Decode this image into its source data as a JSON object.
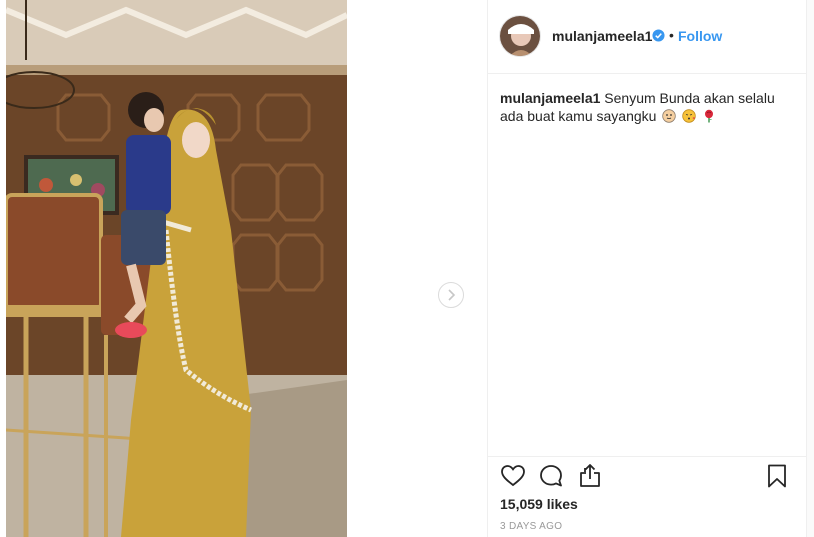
{
  "post": {
    "username": "mulanjameela1",
    "follow_label": "Follow",
    "separator": "•",
    "caption_user": "mulanjameela1",
    "caption_text": "Senyum Bunda akan selalu ada buat kamu sayangku",
    "caption_emojis": [
      "baby-face-icon",
      "kissing-face-icon",
      "rose-icon"
    ],
    "likes": "15,059 likes",
    "time_ago": "3 DAYS AGO"
  },
  "colors": {
    "accent": "#3897f0",
    "text": "#262626",
    "muted": "#999999",
    "border": "#efefef",
    "dress": "#c9a23a"
  },
  "icons": {
    "verified": "verified-badge-icon",
    "next": "chevron-right-icon",
    "like": "heart-icon",
    "comment": "comment-bubble-icon",
    "share": "share-icon",
    "save": "bookmark-icon"
  }
}
